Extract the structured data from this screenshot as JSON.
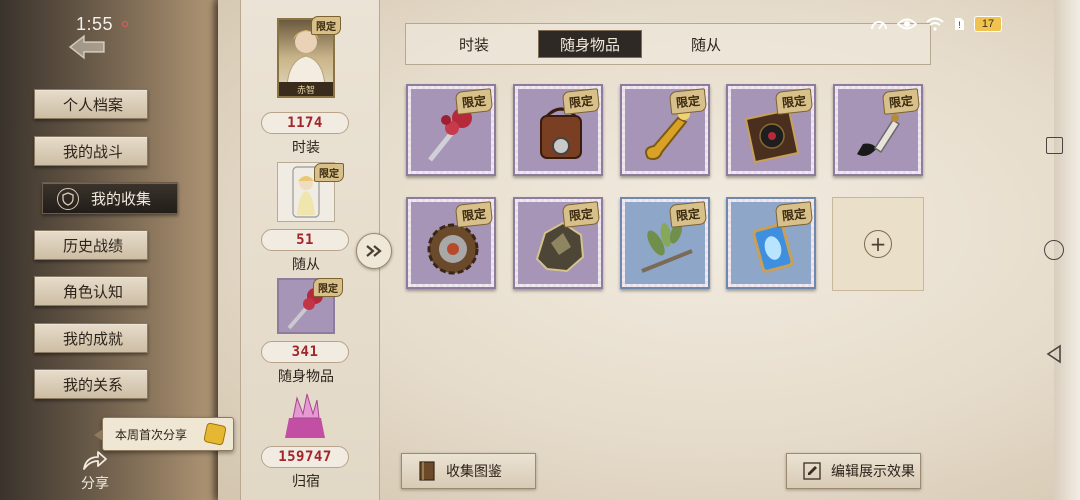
{
  "status_bar": {
    "time": "1:55",
    "battery": "17"
  },
  "menu": {
    "items": [
      {
        "label": "个人档案"
      },
      {
        "label": "我的战斗"
      },
      {
        "label": "我的收集"
      },
      {
        "label": "历史战绩"
      },
      {
        "label": "角色认知"
      },
      {
        "label": "我的成就"
      },
      {
        "label": "我的关系"
      }
    ],
    "active_index": 2
  },
  "share": {
    "tip": "本周首次分享",
    "label": "分享"
  },
  "collection": {
    "cards": [
      {
        "count": "1174",
        "label": "时装",
        "badge": "限定",
        "card_name": "赤智"
      },
      {
        "count": "51",
        "label": "随从",
        "badge": "限定"
      },
      {
        "count": "341",
        "label": "随身物品",
        "badge": "限定"
      },
      {
        "count": "159747",
        "label": "归宿"
      }
    ]
  },
  "tabs": [
    {
      "label": "时装"
    },
    {
      "label": "随身物品"
    },
    {
      "label": "随从"
    }
  ],
  "active_tab": 1,
  "items": [
    {
      "badge": "限定",
      "icon": "rose-scepter-icon"
    },
    {
      "badge": "限定",
      "icon": "camera-bag-icon"
    },
    {
      "badge": "限定",
      "icon": "golden-trumpet-icon"
    },
    {
      "badge": "限定",
      "icon": "gramophone-book-icon"
    },
    {
      "badge": "限定",
      "icon": "black-feather-quill-icon"
    },
    {
      "badge": "限定",
      "icon": "bronze-gear-icon"
    },
    {
      "badge": "限定",
      "icon": "crystal-rock-icon"
    },
    {
      "badge": "限定",
      "icon": "laurel-branch-icon"
    },
    {
      "badge": "限定",
      "icon": "blue-lantern-icon"
    }
  ],
  "buttons": {
    "collection_guide": "收集图鉴",
    "edit_display": "编辑展示效果"
  },
  "colors": {
    "count_red": "#a1262b",
    "stamp_purple": "#a695b6",
    "stamp_blue": "#8ea6c8",
    "limited_gold": "#d8c08a"
  }
}
